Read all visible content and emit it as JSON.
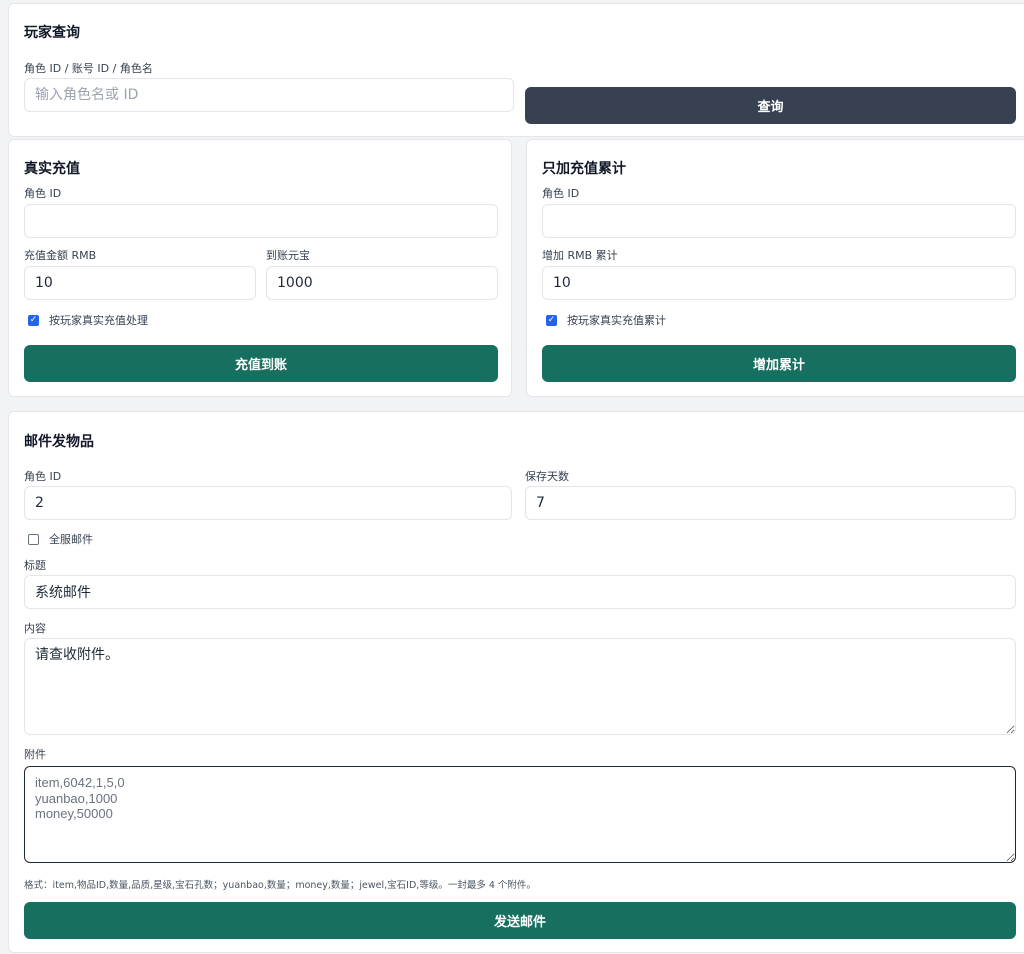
{
  "colors": {
    "accent_green": "#166f5f",
    "accent_dark": "#374151",
    "checkbox": "#2563eb"
  },
  "query": {
    "title": "玩家查询",
    "field_label": "角色 ID / 账号 ID / 角色名",
    "placeholder": "输入角色名或 ID",
    "value": "",
    "button": "查询"
  },
  "recharge": {
    "title": "真实充值",
    "role_label": "角色 ID",
    "role_value": "",
    "amount_label": "充值金额 RMB",
    "amount_value": "10",
    "yuanbao_label": "到账元宝",
    "yuanbao_value": "1000",
    "checkbox_label": "按玩家真实充值处理",
    "checkbox_checked": true,
    "button": "充值到账"
  },
  "accumulate": {
    "title": "只加充值累计",
    "role_label": "角色 ID",
    "role_value": "",
    "amount_label": "增加 RMB 累计",
    "amount_value": "10",
    "checkbox_label": "按玩家真实充值累计",
    "checkbox_checked": true,
    "button": "增加累计"
  },
  "mail": {
    "title": "邮件发物品",
    "role_label": "角色 ID",
    "role_value": "2",
    "days_label": "保存天数",
    "days_value": "7",
    "all_server_label": "全服邮件",
    "all_server_checked": false,
    "subject_label": "标题",
    "subject_value": "系统邮件",
    "content_label": "内容",
    "content_value": "请查收附件。",
    "attach_label": "附件",
    "attach_value": "item,6042,1,5,0\nyuanbao,1000\nmoney,50000",
    "hint": "格式：item,物品ID,数量,品质,星级,宝石孔数；yuanbao,数量；money,数量；jewel,宝石ID,等级。一封最多 4 个附件。",
    "button": "发送邮件"
  }
}
